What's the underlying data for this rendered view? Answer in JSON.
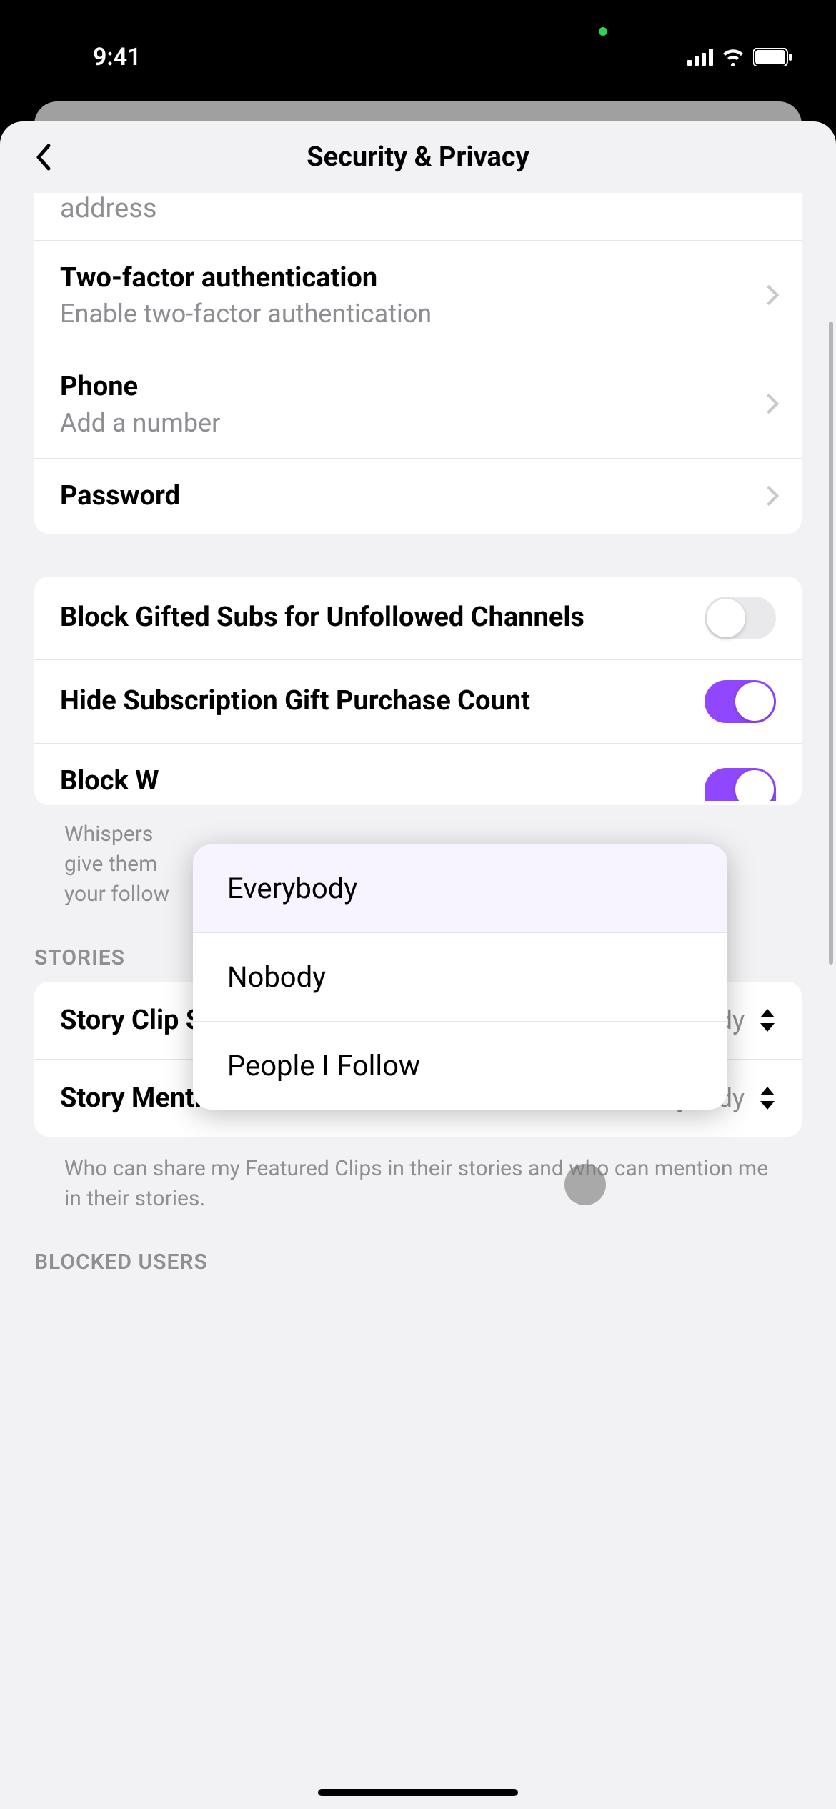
{
  "status": {
    "time": "9:41"
  },
  "header": {
    "title": "Security & Privacy"
  },
  "partial_row_top": "address",
  "account": {
    "twofa": {
      "title": "Two-factor authentication",
      "sub": "Enable two-factor authentication"
    },
    "phone": {
      "title": "Phone",
      "sub": "Add a number"
    },
    "password": {
      "title": "Password"
    }
  },
  "toggles": {
    "block_gifted": {
      "title": "Block Gifted Subs for Unfollowed Channels",
      "on": false
    },
    "hide_gift_count": {
      "title": "Hide Subscription Gift Purchase Count",
      "on": true
    },
    "block_w": {
      "title": "Block W"
    }
  },
  "whisper_help_partial": "Whispers \ngive them \nyour follow",
  "stories": {
    "header": "STORIES",
    "clip_sharing": {
      "label": "Story Clip Sharing",
      "value": "Everybody"
    },
    "mentions": {
      "label": "Story Mentions",
      "value": "Everybody"
    },
    "help": "Who can share my Featured Clips in their stories and who can mention me in their stories."
  },
  "blocked_users_header": "BLOCKED USERS",
  "popover": {
    "opt1": "Everybody",
    "opt2": "Nobody",
    "opt3": "People I Follow"
  }
}
